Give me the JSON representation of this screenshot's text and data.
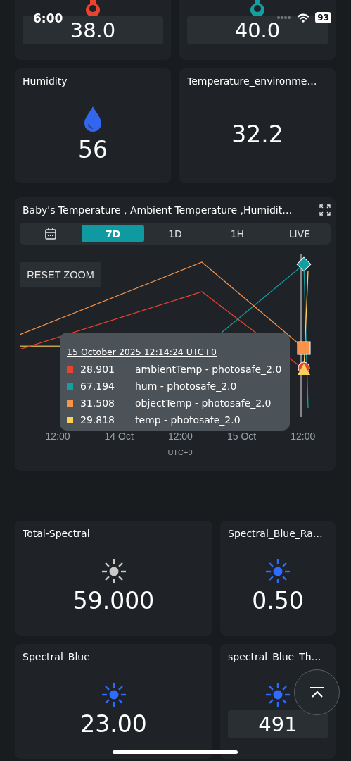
{
  "status_bar": {
    "time": "6:00",
    "battery": "93"
  },
  "top_cards": [
    {
      "kind": "thermometer",
      "color": "#e8432f",
      "value": "38.0",
      "boxed": true
    },
    {
      "kind": "thermometer",
      "color": "#139ea0",
      "value": "40.0",
      "boxed": true
    }
  ],
  "cards": [
    {
      "title": "Humidity",
      "kind": "drop",
      "color": "#3366ee",
      "value": "56",
      "boxed": false
    },
    {
      "title": "Temperature_environme…",
      "kind": "none",
      "value": "32.2",
      "boxed": false
    }
  ],
  "chart": {
    "title": "Baby's Temperature , Ambient Temperature ,Humidit…",
    "tabs": [
      {
        "kind": "calendar",
        "selected": false
      },
      {
        "kind": "text",
        "label": "7D",
        "selected": true
      },
      {
        "kind": "text",
        "label": "1D",
        "selected": false
      },
      {
        "kind": "text",
        "label": "1H",
        "selected": false
      },
      {
        "kind": "text",
        "label": "LIVE",
        "selected": false
      }
    ],
    "reset_button": "RESET ZOOM",
    "x_labels": [
      "12:00",
      "14 Oct",
      "12:00",
      "15 Oct",
      "12:00"
    ],
    "x_title": "UTC+0",
    "tooltip": {
      "title": "15 October 2025 12:14:24 UTC+0",
      "rows": [
        {
          "color": "#e8432f",
          "value": "28.901",
          "label": "ambientTemp - photosafe_2.0"
        },
        {
          "color": "#139ea0",
          "value": "67.194",
          "label": "hum - photosafe_2.0"
        },
        {
          "color": "#f7934a",
          "value": "31.508",
          "label": "objectTemp - photosafe_2.0"
        },
        {
          "color": "#fbd15b",
          "value": "29.818",
          "label": "temp - photosafe_2.0"
        }
      ]
    }
  },
  "spectral_cards": [
    {
      "title": "Total-Spectral",
      "kind": "sun",
      "color": "#c8c8c8",
      "value": "59.000",
      "boxed": false
    },
    {
      "title": "Spectral_Blue_Ra…",
      "kind": "sun",
      "color": "#2f6bff",
      "value": "0.50",
      "boxed": false
    },
    {
      "title": "Spectral_Blue",
      "kind": "sun",
      "color": "#2f6bff",
      "value": "23.00",
      "boxed": false
    },
    {
      "title": "spectral_Blue_Th…",
      "kind": "sun",
      "color": "#2f6bff",
      "value": "491",
      "boxed": true
    }
  ]
}
